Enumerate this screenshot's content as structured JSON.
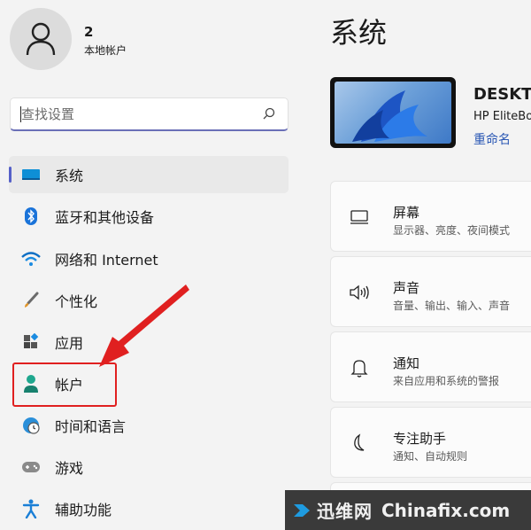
{
  "user": {
    "name": "2",
    "account_type": "本地帐户"
  },
  "search": {
    "placeholder": "查找设置"
  },
  "nav": {
    "items": [
      {
        "label": "系统",
        "icon": "display-icon"
      },
      {
        "label": "蓝牙和其他设备",
        "icon": "bluetooth-icon"
      },
      {
        "label": "网络和 Internet",
        "icon": "wifi-icon"
      },
      {
        "label": "个性化",
        "icon": "brush-icon"
      },
      {
        "label": "应用",
        "icon": "apps-icon"
      },
      {
        "label": "帐户",
        "icon": "account-icon"
      },
      {
        "label": "时间和语言",
        "icon": "globe-clock-icon"
      },
      {
        "label": "游戏",
        "icon": "gamepad-icon"
      },
      {
        "label": "辅助功能",
        "icon": "accessibility-icon"
      }
    ]
  },
  "main": {
    "title": "系统",
    "device": {
      "name": "DESKTO",
      "model": "HP EliteBo",
      "rename_label": "重命名"
    },
    "cards": [
      {
        "title": "屏幕",
        "subtitle": "显示器、亮度、夜间模式",
        "icon": "monitor-icon"
      },
      {
        "title": "声音",
        "subtitle": "音量、输出、输入、声音",
        "icon": "speaker-icon"
      },
      {
        "title": "通知",
        "subtitle": "来自应用和系统的警报",
        "icon": "bell-icon"
      },
      {
        "title": "专注助手",
        "subtitle": "通知、自动规则",
        "icon": "moon-icon"
      }
    ]
  },
  "watermark": {
    "brand_cn": "迅维网",
    "brand_en": "Chinafix.com"
  },
  "colors": {
    "accent": "#5560c8",
    "link": "#2a57b4",
    "annotation": "#e02020"
  }
}
